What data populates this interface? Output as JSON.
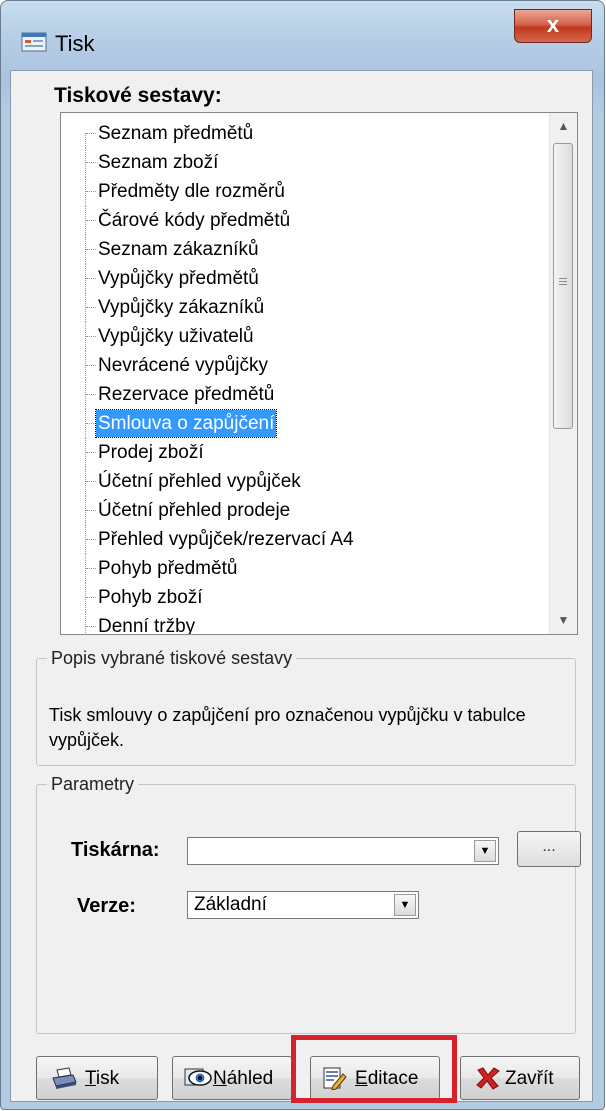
{
  "window": {
    "title": "Tisk",
    "close_glyph": "x",
    "icon": "printer-window-icon"
  },
  "reports": {
    "label": "Tiskové sestavy:",
    "selected_index": 10,
    "items": [
      "Seznam předmětů",
      "Seznam zboží",
      "Předměty dle rozměrů",
      "Čárové kódy předmětů",
      "Seznam zákazníků",
      "Vypůjčky předmětů",
      "Vypůjčky zákazníků",
      "Vypůjčky uživatelů",
      "Nevrácené vypůjčky",
      "Rezervace předmětů",
      "Smlouva o zapůjčení",
      "Prodej zboží",
      "Účetní přehled vypůjček",
      "Účetní přehled prodeje",
      "Přehled vypůjček/rezervací A4",
      "Pohyb předmětů",
      "Pohyb zboží",
      "Denní tržby"
    ]
  },
  "description": {
    "legend": "Popis vybrané tiskové sestavy",
    "text": "Tisk smlouvy o zapůjčení pro označenou vypůjčku v tabulce vypůjček."
  },
  "parameters": {
    "legend": "Parametry",
    "printer_label": "Tiskárna:",
    "printer_value": "",
    "browse_label": "...",
    "version_label": "Verze:",
    "version_value": "Základní"
  },
  "buttons": {
    "print": "Tisk",
    "preview": "Náhled",
    "edit": "Editace",
    "close": "Zavřít"
  },
  "colors": {
    "selection": "#3399ff",
    "highlight_box": "#d7222b",
    "close_red": "#c0391f"
  }
}
